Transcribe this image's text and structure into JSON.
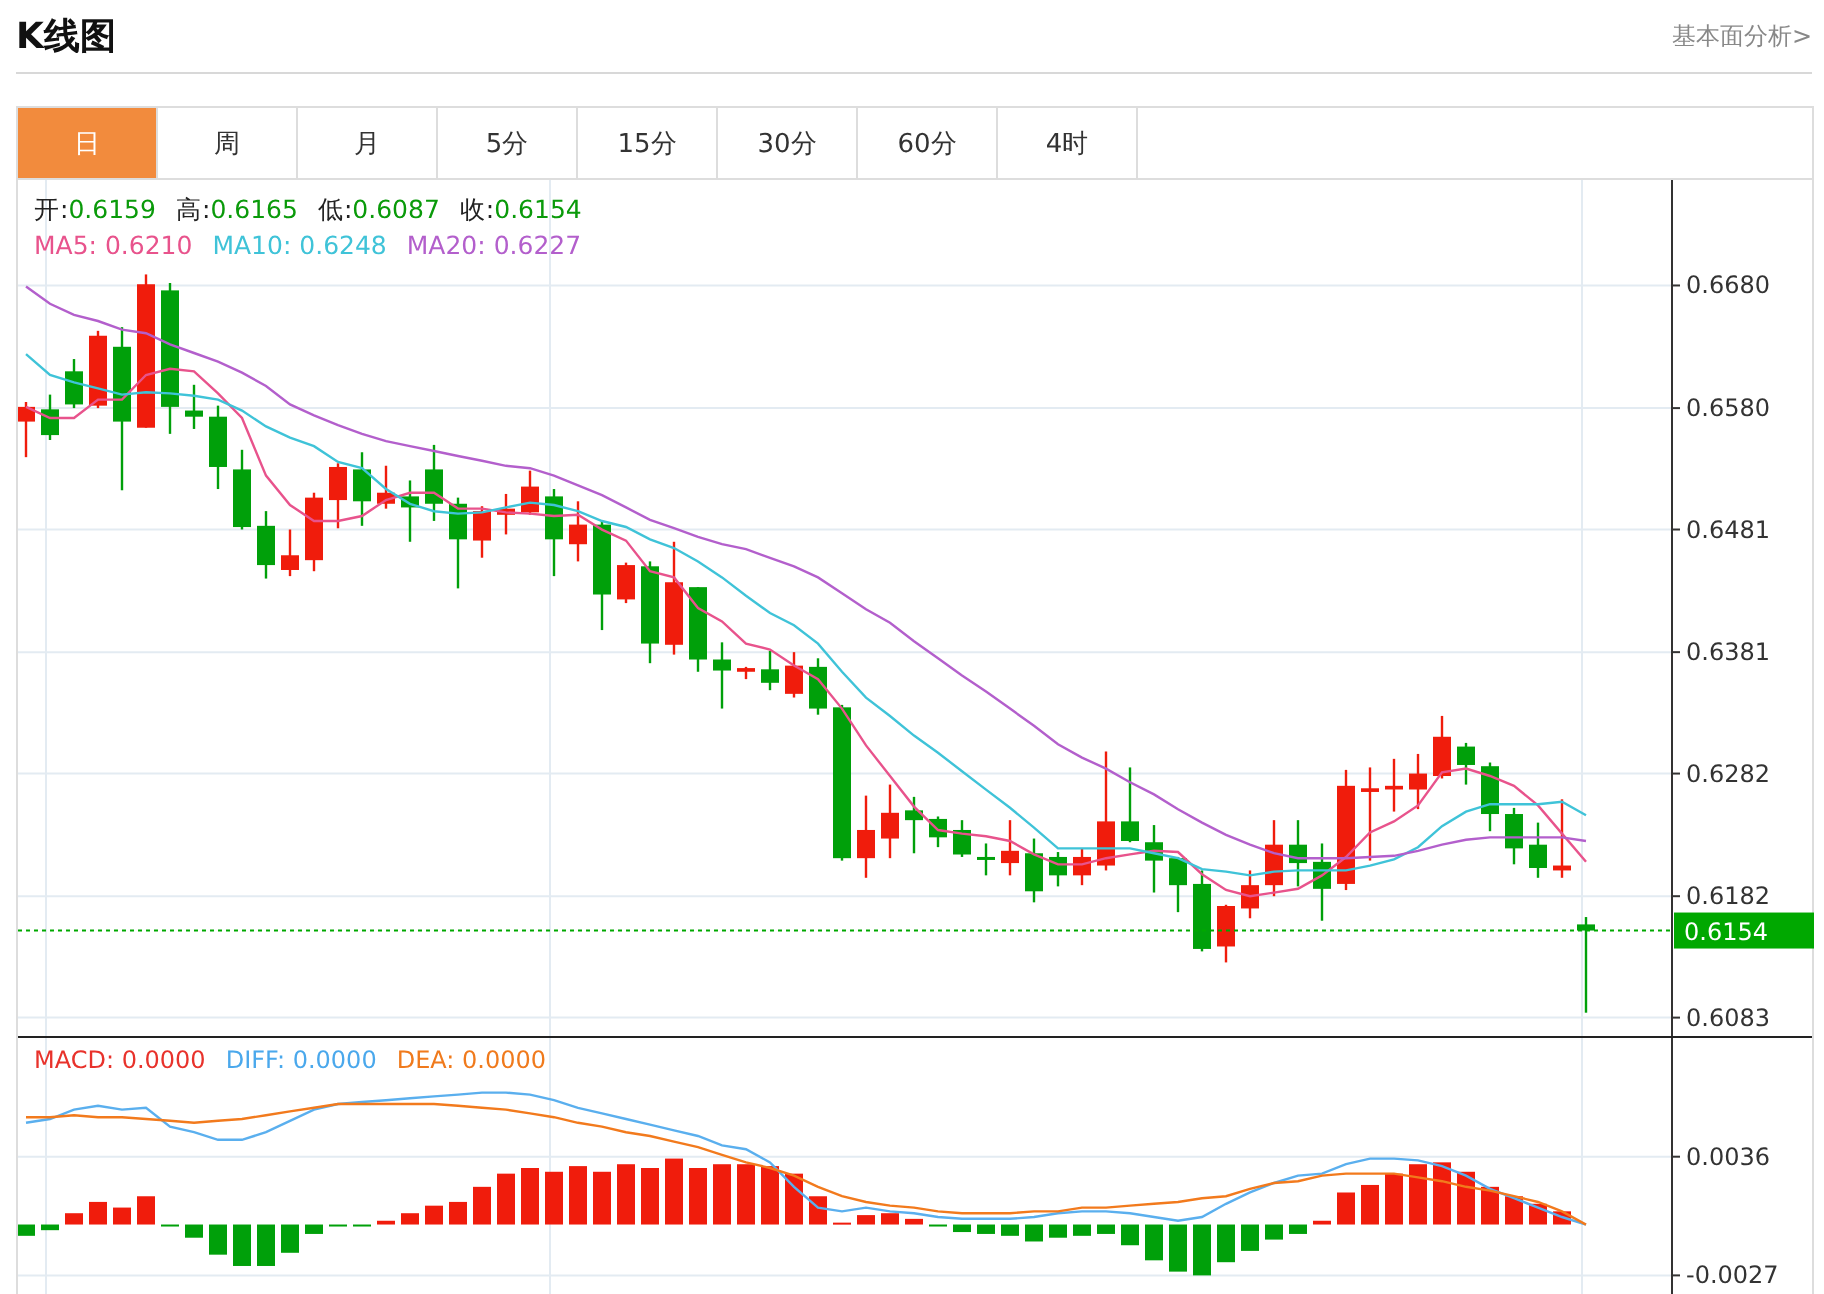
{
  "header": {
    "title": "K线图",
    "link": "基本面分析>"
  },
  "tabs": [
    {
      "label": "日",
      "selected": true
    },
    {
      "label": "周",
      "selected": false
    },
    {
      "label": "月",
      "selected": false
    },
    {
      "label": "5分",
      "selected": false
    },
    {
      "label": "15分",
      "selected": false
    },
    {
      "label": "30分",
      "selected": false
    },
    {
      "label": "60分",
      "selected": false
    },
    {
      "label": "4时",
      "selected": false
    }
  ],
  "legend": {
    "ohlc": [
      {
        "label": "开:",
        "value": "0.6159"
      },
      {
        "label": "高:",
        "value": "0.6165"
      },
      {
        "label": "低:",
        "value": "0.6087"
      },
      {
        "label": "收:",
        "value": "0.6154"
      }
    ],
    "ma": [
      {
        "separator": ":",
        "value": "0.6210"
      },
      {
        "separator": ":",
        "value": "0.6248"
      },
      {
        "separator": ":",
        "value": "0.6227"
      }
    ]
  },
  "main_chart": {
    "chart_data": {
      "type": "candlestick",
      "grid": true,
      "ref_lines": [
        {
          "axis": "y",
          "value": 0.6154,
          "label": "0.6154",
          "color": "#00a800"
        }
      ],
      "ylim": [
        0.6068,
        0.6766
      ],
      "yticks": [
        0.6083,
        0.6182,
        0.6282,
        0.6381,
        0.6481,
        {
          "value": 0.658,
          "label": "0.6580"
        },
        {
          "value": 0.668,
          "label": "0.6680"
        }
      ],
      "ohlc": [
        [
          0.6569,
          0.6585,
          0.654,
          0.6581
        ],
        [
          0.6579,
          0.6591,
          0.6554,
          0.6558
        ],
        [
          0.661,
          0.662,
          0.658,
          0.6583
        ],
        [
          0.6582,
          0.6643,
          0.658,
          0.6639
        ],
        [
          0.663,
          0.6646,
          0.6513,
          0.6569
        ],
        [
          0.6564,
          0.6689,
          0.6564,
          0.6681
        ],
        [
          0.6676,
          0.6682,
          0.6559,
          0.6581
        ],
        [
          0.6578,
          0.6599,
          0.6563,
          0.6573
        ],
        [
          0.6573,
          0.6582,
          0.6514,
          0.6532
        ],
        [
          0.653,
          0.6546,
          0.6481,
          0.6483
        ],
        [
          0.6484,
          0.6496,
          0.6441,
          0.6452
        ],
        [
          0.6448,
          0.6481,
          0.6443,
          0.646
        ],
        [
          0.6456,
          0.6511,
          0.6447,
          0.6507
        ],
        [
          0.6505,
          0.6535,
          0.6482,
          0.6532
        ],
        [
          0.653,
          0.6544,
          0.6484,
          0.6504
        ],
        [
          0.6502,
          0.6533,
          0.6498,
          0.6511
        ],
        [
          0.6508,
          0.6521,
          0.6471,
          0.6499
        ],
        [
          0.653,
          0.655,
          0.6488,
          0.6502
        ],
        [
          0.6502,
          0.6507,
          0.6433,
          0.6473
        ],
        [
          0.6472,
          0.65,
          0.6458,
          0.6496
        ],
        [
          0.6493,
          0.651,
          0.6477,
          0.6498
        ],
        [
          0.6495,
          0.6529,
          0.6493,
          0.6516
        ],
        [
          0.6508,
          0.6514,
          0.6443,
          0.6473
        ],
        [
          0.6469,
          0.6504,
          0.6455,
          0.6485
        ],
        [
          0.6485,
          0.6488,
          0.6399,
          0.6428
        ],
        [
          0.6424,
          0.6454,
          0.6421,
          0.6452
        ],
        [
          0.6451,
          0.6455,
          0.6372,
          0.6388
        ],
        [
          0.6387,
          0.6471,
          0.6379,
          0.6438
        ],
        [
          0.6434,
          0.6434,
          0.6365,
          0.6375
        ],
        [
          0.6375,
          0.6389,
          0.6335,
          0.6366
        ],
        [
          0.6365,
          0.6369,
          0.6359,
          0.6368
        ],
        [
          0.6367,
          0.6382,
          0.635,
          0.6356
        ],
        [
          0.6347,
          0.6381,
          0.6344,
          0.637
        ],
        [
          0.6369,
          0.6376,
          0.633,
          0.6335
        ],
        [
          0.6336,
          0.6338,
          0.6211,
          0.6213
        ],
        [
          0.6213,
          0.6264,
          0.6197,
          0.6236
        ],
        [
          0.6229,
          0.6273,
          0.6213,
          0.625
        ],
        [
          0.6252,
          0.6263,
          0.6217,
          0.6244
        ],
        [
          0.6245,
          0.6247,
          0.6222,
          0.623
        ],
        [
          0.6236,
          0.6244,
          0.6214,
          0.6216
        ],
        [
          0.6214,
          0.6225,
          0.6199,
          0.6213
        ],
        [
          0.6209,
          0.6244,
          0.6199,
          0.6219
        ],
        [
          0.6217,
          0.6229,
          0.6177,
          0.6186
        ],
        [
          0.6214,
          0.6218,
          0.619,
          0.6199
        ],
        [
          0.6199,
          0.6221,
          0.6191,
          0.6214
        ],
        [
          0.6207,
          0.63,
          0.6203,
          0.6243
        ],
        [
          0.6243,
          0.6287,
          0.6226,
          0.6227
        ],
        [
          0.6226,
          0.624,
          0.6185,
          0.6211
        ],
        [
          0.6213,
          0.6214,
          0.6169,
          0.6191
        ],
        [
          0.6192,
          0.6203,
          0.6137,
          0.6139
        ],
        [
          0.6141,
          0.6175,
          0.6128,
          0.6174
        ],
        [
          0.6172,
          0.6203,
          0.6164,
          0.6191
        ],
        [
          0.6191,
          0.6244,
          0.6182,
          0.6224
        ],
        [
          0.6224,
          0.6244,
          0.619,
          0.6209
        ],
        [
          0.621,
          0.6225,
          0.6162,
          0.6188
        ],
        [
          0.6192,
          0.6285,
          0.6187,
          0.6272
        ],
        [
          0.6267,
          0.6287,
          0.6211,
          0.627
        ],
        [
          0.6269,
          0.6294,
          0.6251,
          0.6272
        ],
        [
          0.6269,
          0.6298,
          0.6253,
          0.6282
        ],
        [
          0.628,
          0.6329,
          0.6278,
          0.6312
        ],
        [
          0.6304,
          0.6307,
          0.6273,
          0.6289
        ],
        [
          0.6288,
          0.6291,
          0.6235,
          0.6249
        ],
        [
          0.6249,
          0.6254,
          0.6208,
          0.6221
        ],
        [
          0.6224,
          0.6242,
          0.6197,
          0.6205
        ],
        [
          0.6203,
          0.6261,
          0.6197,
          0.6207
        ],
        [
          0.6159,
          0.6165,
          0.6087,
          0.6154
        ]
      ],
      "series": [
        {
          "name": "MA5",
          "type": "line",
          "color": "#e8538c",
          "values": [
            0.6581,
            0.6572,
            0.6572,
            0.6587,
            0.6587,
            0.6607,
            0.6612,
            0.661,
            0.6592,
            0.6572,
            0.6525,
            0.6501,
            0.6488,
            0.6488,
            0.6492,
            0.6505,
            0.6511,
            0.6511,
            0.6498,
            0.6498,
            0.6495,
            0.6494,
            0.6492,
            0.6493,
            0.6481,
            0.6472,
            0.6447,
            0.6442,
            0.6417,
            0.6406,
            0.6388,
            0.6383,
            0.637,
            0.6359,
            0.6335,
            0.6305,
            0.628,
            0.6255,
            0.6236,
            0.6233,
            0.6231,
            0.6227,
            0.6216,
            0.6208,
            0.6208,
            0.6213,
            0.6216,
            0.6219,
            0.6218,
            0.62,
            0.6187,
            0.6182,
            0.6185,
            0.6188,
            0.6199,
            0.6214,
            0.6234,
            0.6243,
            0.6256,
            0.6283,
            0.6286,
            0.628,
            0.6272,
            0.6256,
            0.6233,
            0.621
          ]
        },
        {
          "name": "MA10",
          "type": "line",
          "color": "#3fc3d8",
          "values": [
            0.6624,
            0.6607,
            0.6601,
            0.6596,
            0.6591,
            0.6593,
            0.6592,
            0.659,
            0.6587,
            0.6578,
            0.6565,
            0.6556,
            0.6549,
            0.6536,
            0.6531,
            0.6514,
            0.6502,
            0.6496,
            0.6494,
            0.6495,
            0.6499,
            0.6503,
            0.6501,
            0.6496,
            0.6488,
            0.6483,
            0.6473,
            0.6466,
            0.6455,
            0.6442,
            0.6427,
            0.6413,
            0.6403,
            0.6388,
            0.6365,
            0.6344,
            0.6329,
            0.6313,
            0.6299,
            0.6284,
            0.6269,
            0.6254,
            0.6238,
            0.6221,
            0.6221,
            0.6221,
            0.6221,
            0.6217,
            0.6213,
            0.6204,
            0.6202,
            0.6199,
            0.6202,
            0.6203,
            0.6203,
            0.6203,
            0.6207,
            0.6212,
            0.6222,
            0.6239,
            0.6251,
            0.6257,
            0.6257,
            0.6257,
            0.6259,
            0.6248
          ]
        },
        {
          "name": "MA20",
          "type": "line",
          "color": "#b35fcc",
          "values": [
            0.6679,
            0.6665,
            0.6656,
            0.6651,
            0.6644,
            0.6641,
            0.6632,
            0.6625,
            0.6618,
            0.6609,
            0.6598,
            0.6583,
            0.6574,
            0.6566,
            0.6559,
            0.6553,
            0.6549,
            0.6545,
            0.6541,
            0.6537,
            0.6533,
            0.6531,
            0.6525,
            0.6517,
            0.6509,
            0.6499,
            0.6489,
            0.6482,
            0.6475,
            0.6469,
            0.6465,
            0.6458,
            0.6451,
            0.6442,
            0.6429,
            0.6416,
            0.6405,
            0.639,
            0.6376,
            0.6362,
            0.6349,
            0.6335,
            0.6321,
            0.6306,
            0.6295,
            0.6286,
            0.6275,
            0.6265,
            0.6253,
            0.6242,
            0.6232,
            0.6224,
            0.6217,
            0.6213,
            0.6213,
            0.6213,
            0.6214,
            0.6215,
            0.6219,
            0.6224,
            0.6228,
            0.623,
            0.623,
            0.623,
            0.623,
            0.6227
          ]
        }
      ]
    }
  },
  "macd_legend": [
    {
      "separator": ":",
      "value": "0.0000",
      "color": "#e8322b"
    },
    {
      "separator": ":",
      "value": "0.0000",
      "color": "#4aa8ec"
    },
    {
      "separator": ":",
      "value": "0.0000",
      "color": "#f07a1c"
    }
  ],
  "macd_chart": {
    "chart_data": {
      "type": "bar",
      "grid": true,
      "ylim": [
        -0.0039,
        0.0099
      ],
      "yticks": [
        -0.0027,
        0.0036
      ],
      "series": [
        {
          "name": "MACD",
          "colors": [
            "#00a00a",
            "#00a00a",
            "#f01c0c",
            "#f01c0c",
            "#f01c0c",
            "#f01c0c",
            "#00a00a",
            "#00a00a",
            "#00a00a",
            "#00a00a",
            "#00a00a",
            "#00a00a",
            "#00a00a",
            "#00a00a",
            "#00a00a",
            "#f01c0c",
            "#f01c0c",
            "#f01c0c",
            "#f01c0c",
            "#f01c0c",
            "#f01c0c",
            "#f01c0c",
            "#f01c0c",
            "#f01c0c",
            "#f01c0c",
            "#f01c0c",
            "#f01c0c",
            "#f01c0c",
            "#f01c0c",
            "#f01c0c",
            "#f01c0c",
            "#f01c0c",
            "#f01c0c",
            "#f01c0c",
            "#f01c0c",
            "#f01c0c",
            "#f01c0c",
            "#f01c0c",
            "#00a00a",
            "#00a00a",
            "#00a00a",
            "#00a00a",
            "#00a00a",
            "#00a00a",
            "#00a00a",
            "#00a00a",
            "#00a00a",
            "#00a00a",
            "#00a00a",
            "#00a00a",
            "#00a00a",
            "#00a00a",
            "#00a00a",
            "#00a00a",
            "#f01c0c",
            "#f01c0c",
            "#f01c0c",
            "#f01c0c",
            "#f01c0c",
            "#f01c0c",
            "#f01c0c",
            "#f01c0c",
            "#f01c0c",
            "#f01c0c",
            "#f01c0c",
            "#f01c0c"
          ],
          "values": [
            -0.0006,
            -0.0003,
            0.0006,
            0.0012,
            0.0009,
            0.0015,
            -0.0001,
            -0.0007,
            -0.0016,
            -0.0022,
            -0.0022,
            -0.0015,
            -0.0005,
            -0.0001,
            -0.0001,
            0.0002,
            0.0006,
            0.001,
            0.0012,
            0.002,
            0.0027,
            0.003,
            0.0028,
            0.0031,
            0.0028,
            0.0032,
            0.003,
            0.0035,
            0.003,
            0.0032,
            0.0032,
            0.0031,
            0.0027,
            0.0015,
            0.0001,
            0.0005,
            0.0006,
            0.0003,
            -0.0001,
            -0.0004,
            -0.0005,
            -0.0006,
            -0.0009,
            -0.0007,
            -0.0006,
            -0.0005,
            -0.0011,
            -0.0019,
            -0.0025,
            -0.0027,
            -0.002,
            -0.0014,
            -0.0008,
            -0.0005,
            0.0002,
            0.0017,
            0.0021,
            0.0027,
            0.0032,
            0.0033,
            0.0028,
            0.002,
            0.0015,
            0.0011,
            0.0007,
            0
          ]
        },
        {
          "name": "DIFF",
          "type": "line",
          "color": "#5aafee",
          "values": [
            0.0054,
            0.0056,
            0.0061,
            0.0063,
            0.0061,
            0.0062,
            0.0052,
            0.0049,
            0.0045,
            0.0045,
            0.0049,
            0.0055,
            0.0061,
            0.0064,
            0.0065,
            0.0066,
            0.0067,
            0.0068,
            0.0069,
            0.007,
            0.007,
            0.0069,
            0.0066,
            0.0062,
            0.0059,
            0.0056,
            0.0053,
            0.005,
            0.0047,
            0.0042,
            0.004,
            0.0033,
            0.002,
            0.0009,
            0.0007,
            0.0009,
            0.0007,
            0.0006,
            0.0004,
            0.0003,
            0.0003,
            0.0003,
            0.0004,
            0.0006,
            0.0007,
            0.0007,
            0.0006,
            0.0004,
            0.0002,
            0.0004,
            0.0011,
            0.0017,
            0.0022,
            0.0026,
            0.0027,
            0.0032,
            0.0035,
            0.0035,
            0.0034,
            0.0031,
            0.0026,
            0.0019,
            0.0014,
            0.0009,
            0.0004,
            0
          ]
        },
        {
          "name": "DEA",
          "type": "line",
          "color": "#f27a1d",
          "values": [
            0.0057,
            0.0057,
            0.0058,
            0.0057,
            0.0057,
            0.0056,
            0.0055,
            0.0054,
            0.0055,
            0.0056,
            0.0058,
            0.006,
            0.0062,
            0.0064,
            0.0064,
            0.0064,
            0.0064,
            0.0064,
            0.0063,
            0.0062,
            0.0061,
            0.0059,
            0.0057,
            0.0054,
            0.0052,
            0.0049,
            0.0047,
            0.0044,
            0.0041,
            0.0037,
            0.0033,
            0.003,
            0.0026,
            0.002,
            0.0015,
            0.0012,
            0.001,
            0.0009,
            0.0007,
            0.0006,
            0.0006,
            0.0006,
            0.0007,
            0.0007,
            0.0009,
            0.0009,
            0.001,
            0.0011,
            0.0012,
            0.0014,
            0.0015,
            0.0019,
            0.0022,
            0.0023,
            0.0026,
            0.0027,
            0.0027,
            0.0027,
            0.0025,
            0.0023,
            0.002,
            0.0018,
            0.0015,
            0.0012,
            0.0007,
            0
          ]
        }
      ]
    }
  }
}
